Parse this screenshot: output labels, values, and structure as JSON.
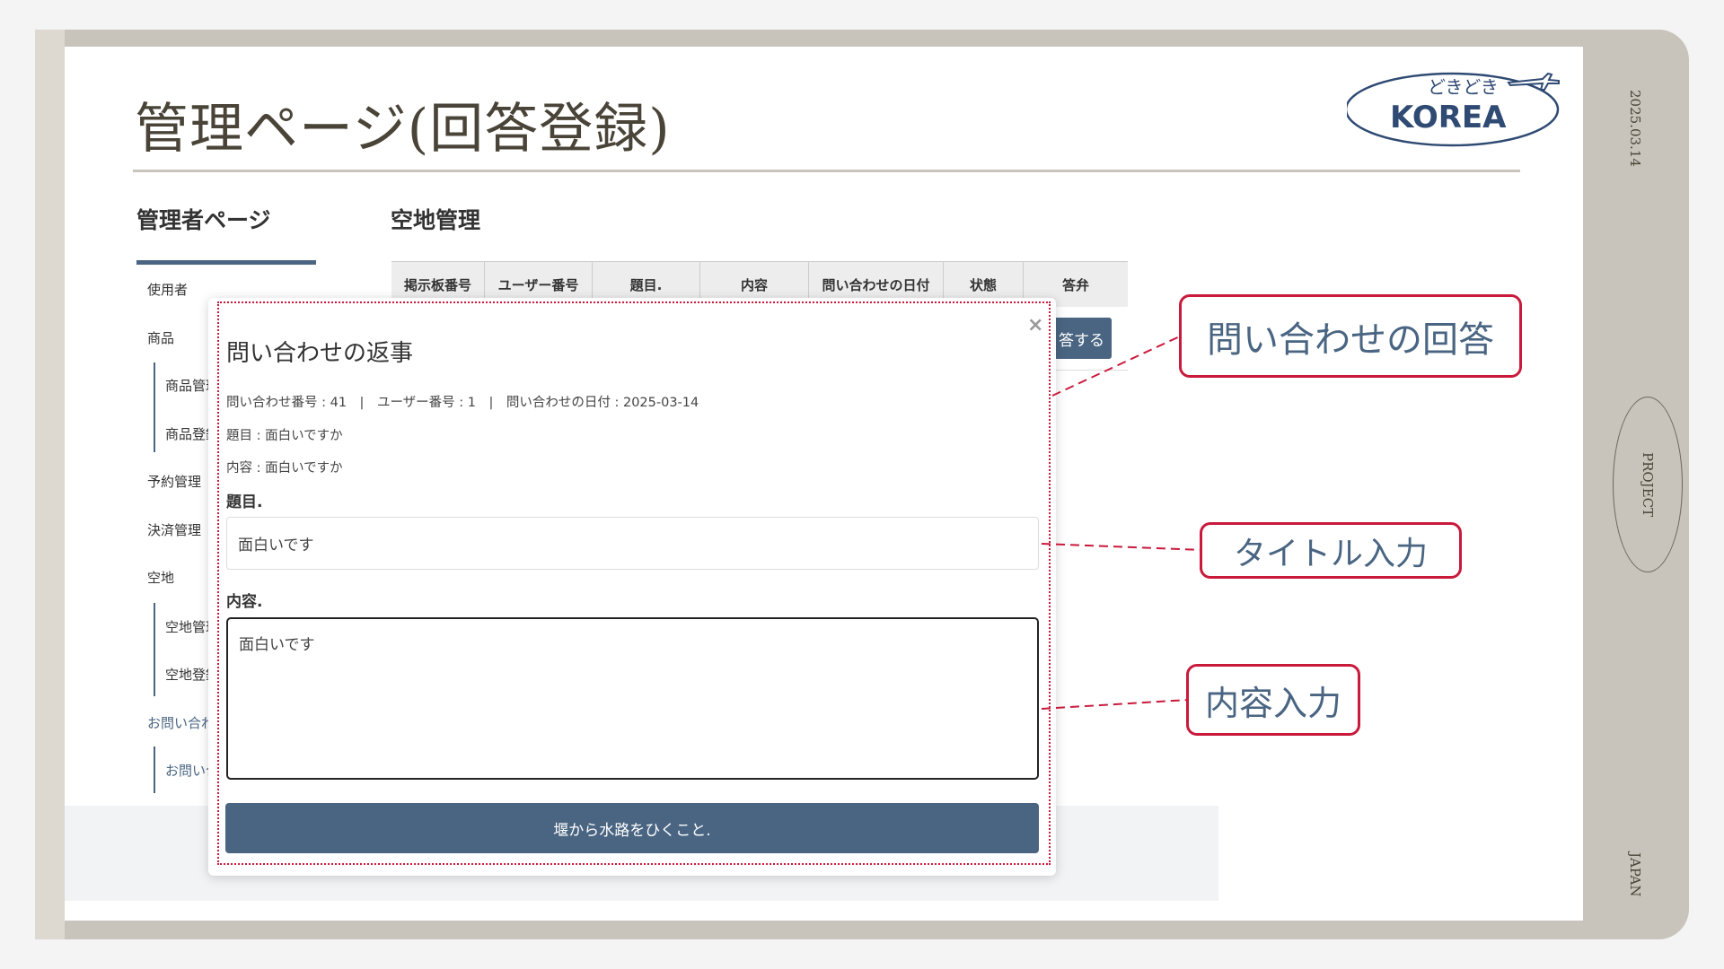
{
  "slide": {
    "title": "管理ページ(回答登録)",
    "date": "2025.03.14",
    "project": "PROJECT",
    "country": "JAPAN",
    "logo": {
      "top": "どきどき",
      "bottom": "KOREA"
    }
  },
  "admin": {
    "heading": "管理者ページ",
    "sidebar": {
      "user": "使用者",
      "product": "商品",
      "product_manage": "商品管理",
      "product_register": "商品登録",
      "reservation": "予約管理",
      "payment": "決済管理",
      "space": "空地",
      "space_manage": "空地管理",
      "space_register": "空地登録",
      "inquiry": "お問い合わせ",
      "inquiry_manage": "お問い合わせ管理"
    },
    "section_title": "空地管理",
    "table_headers": [
      "掲示板番号",
      "ユーザー番号",
      "題目.",
      "内容",
      "問い合わせの日付",
      "状態",
      "答弁"
    ],
    "answer_button": "答する"
  },
  "modal": {
    "title": "問い合わせの返事",
    "meta_line": "問い合わせ番号 : 41　|　ユーザー番号 : 1　|　問い合わせの日付 : 2025-03-14",
    "subject_line": "題目 : 面白いですか",
    "content_line": "内容 : 面白いですか",
    "title_label": "題目.",
    "title_value": "面白いです",
    "content_label": "内容.",
    "content_value": "面白いです",
    "submit_label": "堰から水路をひくこと.",
    "close": "×"
  },
  "callouts": {
    "reply": "問い合わせの回答",
    "title_input": "タイトル入力",
    "content_input": "内容入力"
  },
  "colors": {
    "accent": "#4a6582",
    "callout_border": "#c91a3c",
    "frame": "#c8c4bb"
  }
}
